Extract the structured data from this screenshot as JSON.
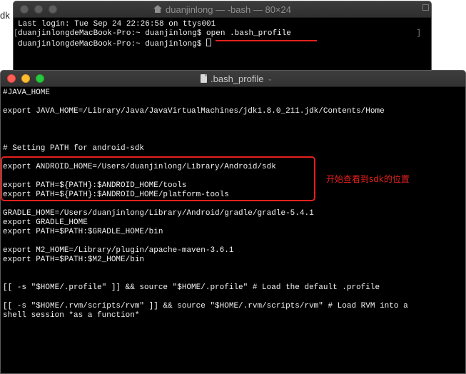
{
  "background": {
    "partial_text": "dk"
  },
  "back_window": {
    "title": "duanjinlong — -bash — 80×24",
    "lines": [
      "Last login: Tue Sep 24 22:26:58 on ttys001",
      "duanjinlongdeMacBook-Pro:~ duanjinlong$ open .bash_profile",
      "duanjinlongdeMacBook-Pro:~ duanjinlong$ "
    ]
  },
  "front_window": {
    "title": ".bash_profile",
    "lines": [
      "#JAVA_HOME",
      "",
      "export JAVA_HOME=/Library/Java/JavaVirtualMachines/jdk1.8.0_211.jdk/Contents/Home",
      "",
      "",
      "",
      "# Setting PATH for android-sdk",
      "",
      "export ANDROID_HOME=/Users/duanjinlong/Library/Android/sdk",
      "",
      "export PATH=${PATH}:$ANDROID_HOME/tools",
      "export PATH=${PATH}:$ANDROID_HOME/platform-tools",
      "",
      "GRADLE_HOME=/Users/duanjinlong/Library/Android/gradle/gradle-5.4.1",
      "export GRADLE_HOME",
      "export PATH=$PATH:$GRADLE_HOME/bin",
      "",
      "export M2_HOME=/Library/plugin/apache-maven-3.6.1",
      "export PATH=$PATH:$M2_HOME/bin",
      "",
      "",
      "[[ -s \"$HOME/.profile\" ]] && source \"$HOME/.profile\" # Load the default .profile",
      "",
      "[[ -s \"$HOME/.rvm/scripts/rvm\" ]] && source \"$HOME/.rvm/scripts/rvm\" # Load RVM into a",
      "shell session *as a function*"
    ]
  },
  "annotation": {
    "text": "开始查看到sdk的位置",
    "color": "#e3211f"
  },
  "colors": {
    "terminal_bg": "#000000",
    "terminal_fg": "#f2f2f2",
    "highlight": "#e3211f"
  }
}
